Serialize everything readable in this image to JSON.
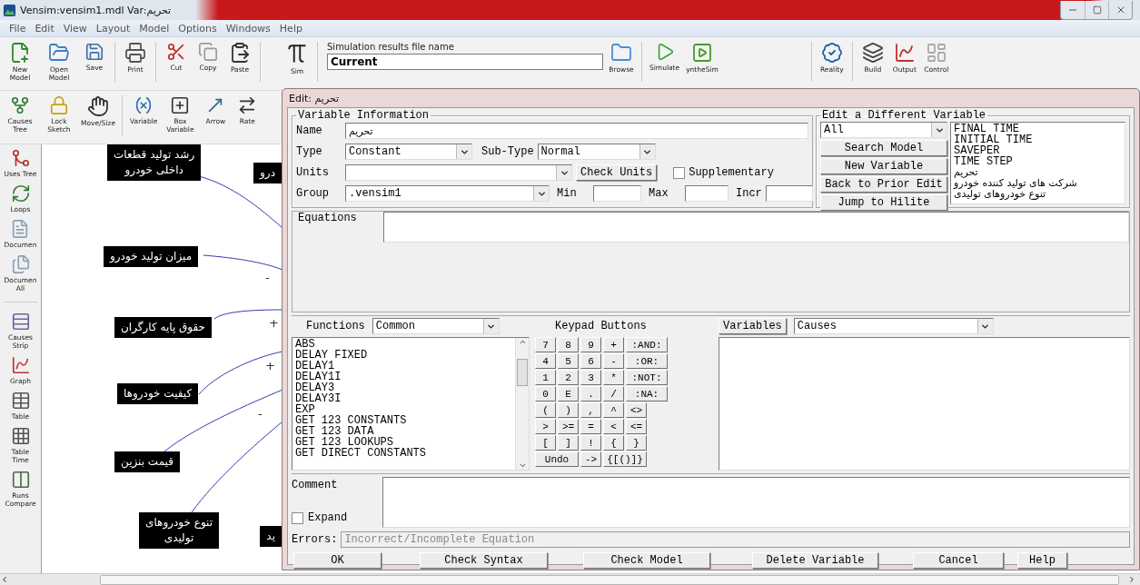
{
  "window": {
    "title": "Vensim:vensim1.mdl Var:تحریم"
  },
  "menu": [
    "File",
    "Edit",
    "View",
    "Layout",
    "Model",
    "Options",
    "Windows",
    "Help"
  ],
  "toolbar": {
    "groups": [
      [
        {
          "label": "New Model"
        },
        {
          "label": "Open Model"
        },
        {
          "label": "Save"
        }
      ],
      [
        {
          "label": "Print"
        }
      ],
      [
        {
          "label": "Cut"
        },
        {
          "label": "Copy"
        },
        {
          "label": "Paste"
        }
      ],
      [
        {
          "label": "Sim"
        }
      ]
    ],
    "results_label": "Simulation results file name",
    "results_file": "Current",
    "run_groups": [
      [
        {
          "label": "Browse"
        }
      ],
      [
        {
          "label": "Simulate"
        },
        {
          "label": "yntheSim"
        }
      ],
      [
        {
          "label": "Reality"
        }
      ],
      [
        {
          "label": "Build"
        },
        {
          "label": "Output"
        },
        {
          "label": "Control"
        }
      ]
    ]
  },
  "sketch_tools": [
    [
      {
        "label": "Causes Tree"
      },
      {
        "label": "Lock Sketch"
      },
      {
        "label": "Move/Size"
      }
    ],
    [
      {
        "label": "Variable"
      },
      {
        "label": "Box Variable"
      },
      {
        "label": "Arrow"
      },
      {
        "label": "Rate"
      }
    ]
  ],
  "side_tools": [
    [
      {
        "label": "Uses Tree"
      },
      {
        "label": "Loops"
      },
      {
        "label": "Documen"
      },
      {
        "label": "Documen All"
      }
    ],
    [
      {
        "label": "Causes Strip"
      },
      {
        "label": "Graph"
      },
      {
        "label": "Table"
      },
      {
        "label": "Table Time"
      },
      {
        "label": "Runs Compare"
      }
    ]
  ],
  "canvas": {
    "nodes": [
      {
        "text": "رشد تولید قطعات\nداخلی خودرو"
      },
      {
        "text": "میزان تولید خودرو"
      },
      {
        "text": "حقوق پایه کارگران"
      },
      {
        "text": "کیفیت خودروها"
      },
      {
        "text": "قیمت بنزین"
      },
      {
        "text": "تنوع خودروهای\nتولیدی"
      },
      {
        "text": "درو"
      },
      {
        "text": "ید"
      }
    ],
    "signs": [
      "-",
      "+",
      "+",
      "-"
    ]
  },
  "dialog": {
    "title": "Edit: تحریم",
    "variable_info": {
      "legend": "Variable Information",
      "name_label": "Name",
      "name": "تحریم",
      "type_label": "Type",
      "type": "Constant",
      "subtype_label": "Sub-Type",
      "subtype": "Normal",
      "units_label": "Units",
      "check_units": "Check Units",
      "supplementary": {
        "label": "Supplementary",
        "checked": false
      },
      "group_label": "Group",
      "group": ".vensim1",
      "min_label": "Min",
      "max_label": "Max",
      "incr_label": "Incr"
    },
    "different": {
      "legend": "Edit a Different Variable",
      "filter": "All",
      "buttons": [
        "Search Model",
        "New Variable",
        "Back to Prior Edit",
        "Jump to Hilite"
      ],
      "variables": [
        "FINAL TIME",
        "INITIAL TIME",
        "SAVEPER",
        "TIME STEP",
        "تحریم",
        "شرکت های تولید کننده خودرو",
        "تنوع خودروهای تولیدی"
      ]
    },
    "equations_label": "Equations",
    "functions": {
      "label": "Functions",
      "set": "Common",
      "items": [
        "ABS",
        "DELAY FIXED",
        "DELAY1",
        "DELAY1I",
        "DELAY3",
        "DELAY3I",
        "EXP",
        "GET 123 CONSTANTS",
        "GET 123 DATA",
        "GET 123 LOOKUPS",
        "GET DIRECT CONSTANTS"
      ]
    },
    "keypad": {
      "label": "Keypad Buttons",
      "keys": [
        {
          "label": "7",
          "kind": "key"
        },
        {
          "label": "8",
          "kind": "key"
        },
        {
          "label": "9",
          "kind": "key"
        },
        {
          "label": "+",
          "kind": "key"
        },
        {
          "label": ":AND:",
          "kind": "key"
        },
        {
          "label": "4",
          "kind": "key"
        },
        {
          "label": "5",
          "kind": "key"
        },
        {
          "label": "6",
          "kind": "key"
        },
        {
          "label": "-",
          "kind": "key"
        },
        {
          "label": ":OR:",
          "kind": "key"
        },
        {
          "label": "1",
          "kind": "key"
        },
        {
          "label": "2",
          "kind": "key"
        },
        {
          "label": "3",
          "kind": "key"
        },
        {
          "label": "*",
          "kind": "key"
        },
        {
          "label": ":NOT:",
          "kind": "key"
        },
        {
          "label": "0",
          "kind": "key"
        },
        {
          "label": "E",
          "kind": "key"
        },
        {
          "label": ".",
          "kind": "key"
        },
        {
          "label": "/",
          "kind": "key"
        },
        {
          "label": ":NA:",
          "kind": "key"
        },
        {
          "label": "(",
          "kind": "key"
        },
        {
          "label": ")",
          "kind": "key"
        },
        {
          "label": ",",
          "kind": "key"
        },
        {
          "label": "^",
          "kind": "key"
        },
        {
          "label": "<>",
          "kind": "key"
        },
        {
          "label": ">",
          "kind": "key"
        },
        {
          "label": ">=",
          "kind": "key"
        },
        {
          "label": "=",
          "kind": "key"
        },
        {
          "label": "<",
          "kind": "key"
        },
        {
          "label": "<=",
          "kind": "key"
        },
        {
          "label": "[",
          "kind": "key"
        },
        {
          "label": "]",
          "kind": "key"
        },
        {
          "label": "!",
          "kind": "key"
        },
        {
          "label": "{",
          "kind": "key"
        },
        {
          "label": "}",
          "kind": "key"
        },
        {
          "label": "Undo",
          "kind": "wide"
        },
        {
          "label": "->",
          "kind": "key"
        },
        {
          "label": "{[()]}",
          "kind": "wide"
        }
      ]
    },
    "variables": {
      "button": "Variables",
      "filter": "Causes"
    },
    "comment_label": "Comment",
    "expand": {
      "label": "Expand",
      "checked": false
    },
    "errors_label": "Errors:",
    "errors": "Incorrect/Incomplete Equation",
    "buttons": [
      "OK",
      "Check Syntax",
      "Check Model",
      "Delete Variable",
      "Cancel",
      "Help"
    ]
  }
}
